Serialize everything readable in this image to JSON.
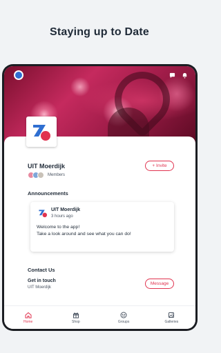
{
  "headline": "Staying up to Date",
  "org": {
    "name": "UIT Moerdijk",
    "members_label": "Members",
    "invite_label": "+ Invite"
  },
  "announcements": {
    "title": "Announcements",
    "post": {
      "author": "UIT Moerdijk",
      "time": "3 hours ago",
      "line1": "Welcome to the app!",
      "line2": "Take a look around and see what you can do!"
    }
  },
  "contact": {
    "title": "Contact Us",
    "get_in_touch": "Get in touch",
    "org_name": "UIT Moerdijk",
    "message_label": "Message"
  },
  "tabs": [
    {
      "label": "Home",
      "icon": "home-icon",
      "active": true
    },
    {
      "label": "Shop",
      "icon": "shop-icon",
      "active": false
    },
    {
      "label": "Groups",
      "icon": "groups-icon",
      "active": false
    },
    {
      "label": "Galleries",
      "icon": "galleries-icon",
      "active": false
    }
  ],
  "colors": {
    "accent": "#e0324e",
    "logo_blue": "#2f6fd1",
    "logo_red": "#e0324e"
  }
}
